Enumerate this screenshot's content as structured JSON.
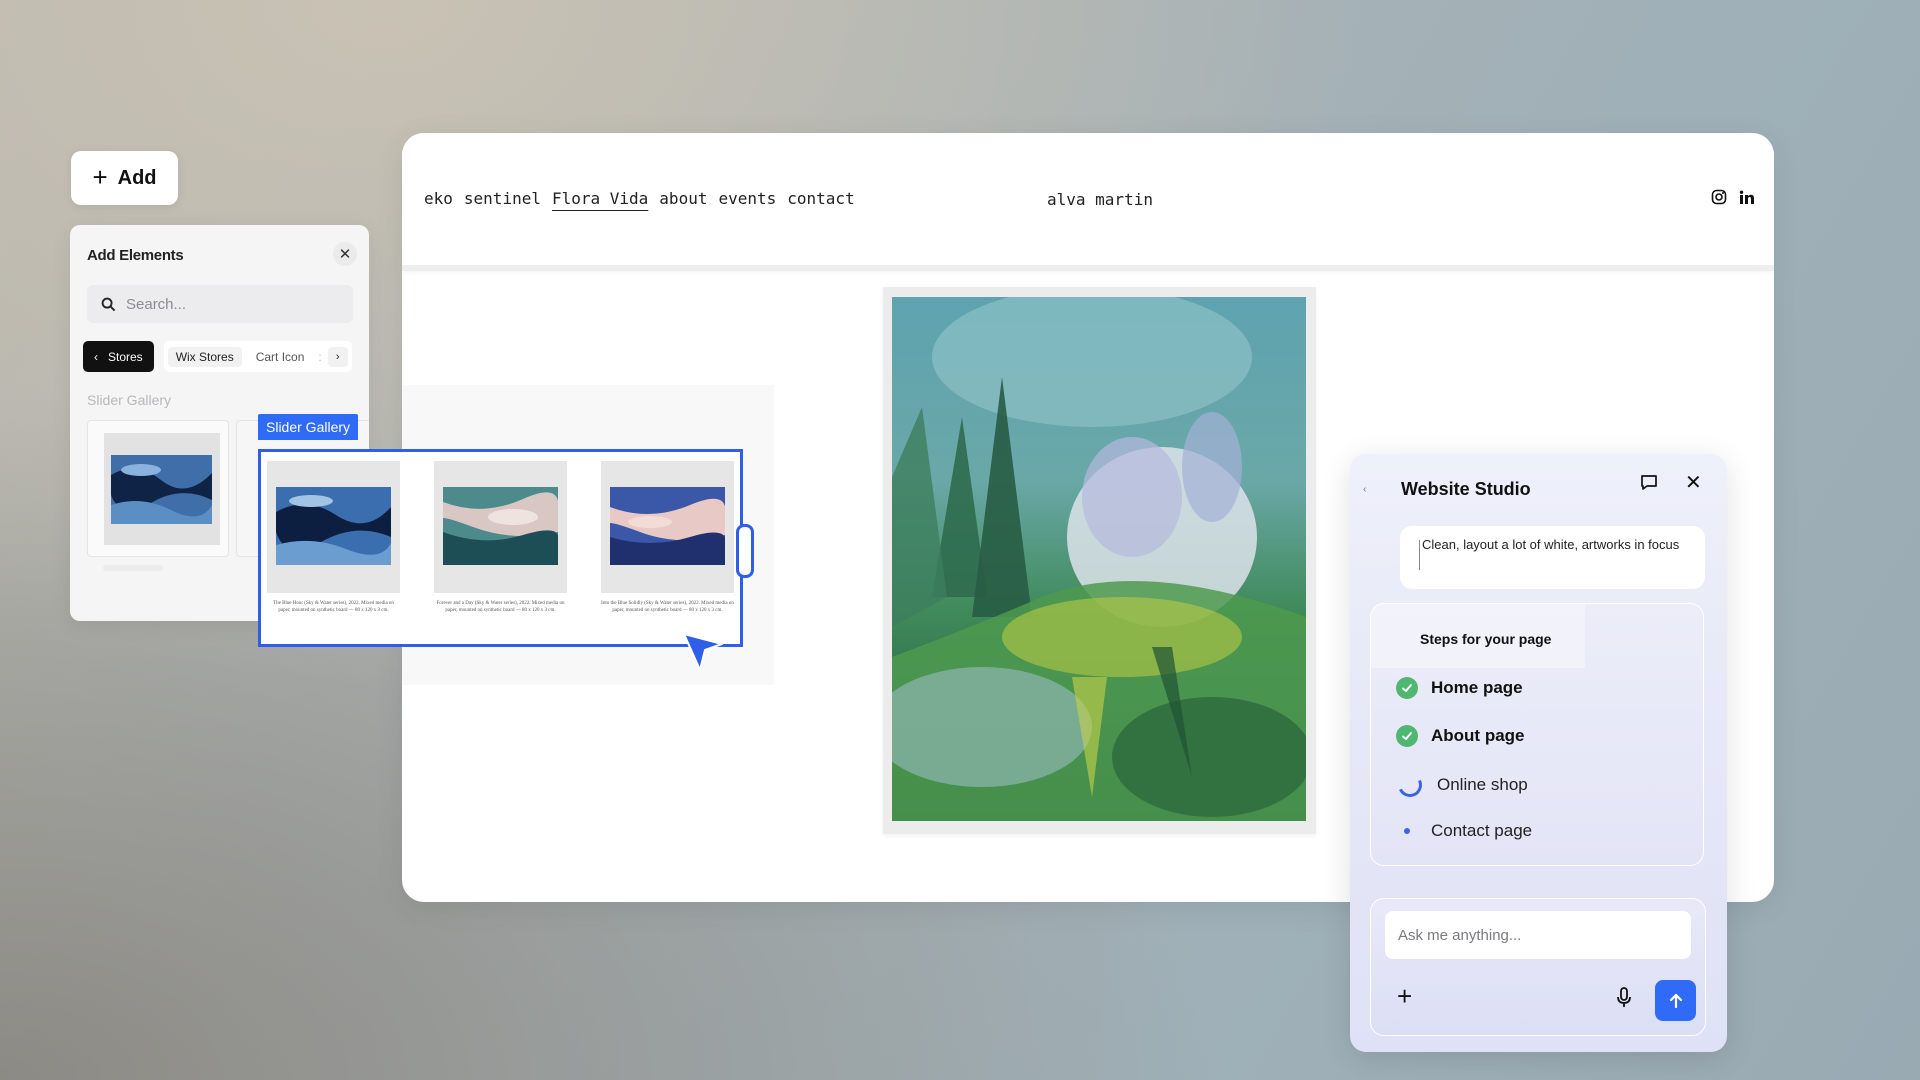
{
  "add_button": {
    "label": "Add"
  },
  "add_panel": {
    "title": "Add Elements",
    "search_placeholder": "Search...",
    "chips": {
      "back": "Stores",
      "wix_stores": "Wix Stores",
      "cart_icon": "Cart Icon"
    },
    "section_label": "Slider Gallery"
  },
  "site": {
    "nav": [
      "eko",
      "sentinel",
      "Flora Vida",
      "about",
      "events",
      "contact"
    ],
    "active_nav": "Flora Vida",
    "brand": "alva martin"
  },
  "slider_gallery": {
    "label": "Slider Gallery",
    "captions": [
      "The Blue Hour (Sky & Water series), 2022. Mixed media on paper, mounted on synthetic board — 80 x 120 x 3 cm.",
      "Forever and a Day (Sky & Water series), 2022. Mixed media on paper, mounted on synthetic board — 80 x 120 x 3 cm.",
      "Into the Blue Solidly (Sky & Water series), 2022. Mixed media on paper, mounted on synthetic board — 80 x 120 x 3 cm."
    ]
  },
  "studio": {
    "title": "Website Studio",
    "prompt": "Clean, layout a lot of white, artworks in focus",
    "steps_title": "Steps for your page",
    "steps": [
      {
        "label": "Home page",
        "status": "done"
      },
      {
        "label": "About page",
        "status": "done"
      },
      {
        "label": "Online shop",
        "status": "in-progress"
      },
      {
        "label": "Contact page",
        "status": "pending"
      }
    ],
    "input_placeholder": "Ask me anything..."
  },
  "colors": {
    "accent": "#2f6bf6",
    "check": "#4fb772"
  }
}
